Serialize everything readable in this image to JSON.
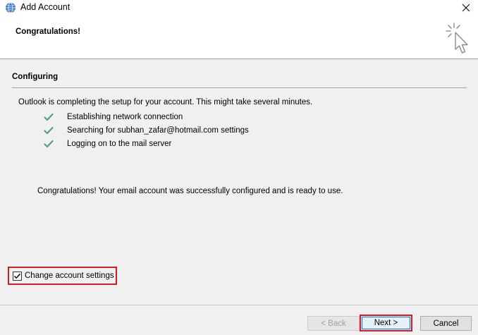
{
  "window": {
    "title": "Add Account",
    "close_glyph": "✕"
  },
  "header": {
    "title": "Congratulations!",
    "icon": "wizard-cursor-icon"
  },
  "section": {
    "title": "Configuring",
    "intro": "Outlook is completing the setup for your account. This might take several minutes.",
    "steps": [
      {
        "label": "Establishing network connection",
        "status": "done"
      },
      {
        "label": "Searching for subhan_zafar@hotmail.com settings",
        "status": "done"
      },
      {
        "label": "Logging on to the mail server",
        "status": "done"
      }
    ],
    "success": "Congratulations! Your email account was successfully configured and is ready to use."
  },
  "options": {
    "change_settings_label": "Change account settings",
    "change_settings_checked": true
  },
  "buttons": {
    "back": "< Back",
    "next": "Next >",
    "cancel": "Cancel"
  },
  "colors": {
    "check_green": "#5a9e7d",
    "highlight_red": "#d11a2a"
  }
}
